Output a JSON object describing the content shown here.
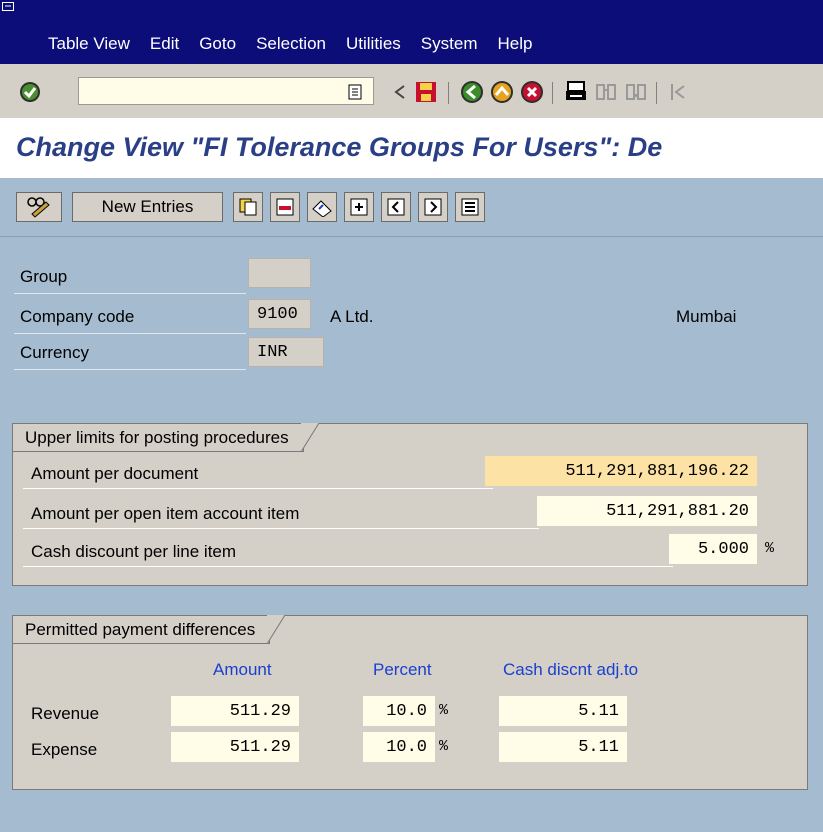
{
  "menubar": {
    "items": [
      "Table View",
      "Edit",
      "Goto",
      "Selection",
      "Utilities",
      "System",
      "Help"
    ]
  },
  "toolbar": {
    "command_field": "",
    "icons": [
      "check-icon",
      "dropdown-icon",
      "back-arrow-icon",
      "save-icon",
      "back-icon",
      "exit-icon",
      "cancel-icon",
      "print-icon",
      "find-icon",
      "find-next-icon",
      "first-page-icon"
    ]
  },
  "title": "Change View \"FI Tolerance Groups For Users\": De",
  "app_toolbar": {
    "new_entries_label": "New Entries"
  },
  "header": {
    "group_label": "Group",
    "group_value": "",
    "company_code_label": "Company code",
    "company_code_value": "9100",
    "company_name": "A Ltd.",
    "city": "Mumbai",
    "currency_label": "Currency",
    "currency_value": "INR"
  },
  "upper_limits": {
    "title": "Upper limits for posting procedures",
    "rows": [
      {
        "label": "Amount per document",
        "value": "511,291,881,196.22"
      },
      {
        "label": "Amount per open item account item",
        "value": "511,291,881.20"
      },
      {
        "label": "Cash discount per line item",
        "value": "5.000",
        "unit": "%"
      }
    ]
  },
  "payment_diff": {
    "title": "Permitted payment differences",
    "col_amount": "Amount",
    "col_percent": "Percent",
    "col_cash": "Cash discnt adj.to",
    "rows": [
      {
        "label": "Revenue",
        "amount": "511.29",
        "percent": "10.0",
        "unit": "%",
        "cash": "5.11"
      },
      {
        "label": "Expense",
        "amount": "511.29",
        "percent": "10.0",
        "unit": "%",
        "cash": "5.11"
      }
    ]
  }
}
